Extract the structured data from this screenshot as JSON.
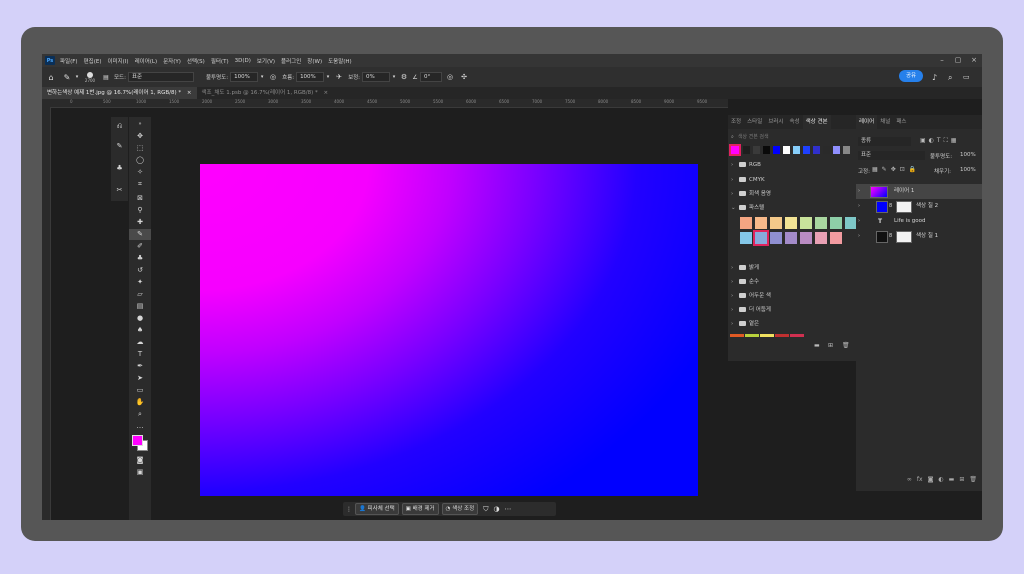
{
  "menu": {
    "logo": "Ps",
    "items": [
      "파일(F)",
      "편집(E)",
      "이미지(I)",
      "레이어(L)",
      "문자(Y)",
      "선택(S)",
      "필터(T)",
      "3D(D)",
      "보기(V)",
      "플러그인",
      "창(W)",
      "도움말(H)"
    ]
  },
  "options": {
    "brush_size": "2700",
    "mode_label": "모드:",
    "mode_value": "표준",
    "opacity_label": "불투명도:",
    "opacity_value": "100%",
    "flow_label": "흐름:",
    "flow_value": "100%",
    "smoothing_label": "보정:",
    "smoothing_value": "0%",
    "angle_value": "0°",
    "share_label": "공유"
  },
  "tabs": [
    {
      "label": "변하는색상 예제 1번.jpg @ 16.7%(레이어 1, RGB/8) *",
      "close": "×"
    },
    {
      "label": "색조_채도 1.psb @ 16.7%(레이어 1, RGB/8) *",
      "close": "×"
    }
  ],
  "ruler_ticks": [
    "0",
    "500",
    "1000",
    "1500",
    "2000",
    "2500",
    "3000",
    "3500",
    "4000",
    "4500",
    "5000",
    "5500",
    "6000",
    "6500",
    "7000",
    "7500",
    "8000",
    "8500",
    "9000",
    "9500"
  ],
  "taskbar": {
    "subject_label": "피사체 선택",
    "remove_bg_label": "배경 제거",
    "color_adjust_label": "색상 조정"
  },
  "swatches": {
    "tabs": [
      "조정",
      "스타일",
      "브러시",
      "속성",
      "색상 견본"
    ],
    "search_placeholder": "색상 견본 검색",
    "recent": [
      "#ff00ff",
      "#1e1e1e",
      "#3a3a3a",
      "#0a0a0a",
      "#0000ff",
      "#ffffff",
      "#87cefa",
      "#1e40ff",
      "#3030cc",
      "#2a2a2a",
      "#9090ff",
      "#888888"
    ],
    "groups": [
      {
        "label": "RGB",
        "open": false
      },
      {
        "label": "CMYK",
        "open": false
      },
      {
        "label": "회색 음영",
        "open": false
      },
      {
        "label": "파스텔",
        "open": true
      },
      {
        "label": "밝게",
        "open": false
      },
      {
        "label": "순수",
        "open": false
      },
      {
        "label": "어두운 색",
        "open": false
      },
      {
        "label": "더 어둡게",
        "open": false
      },
      {
        "label": "옅은",
        "open": false
      }
    ],
    "pastel": [
      "#f4a582",
      "#f7b98a",
      "#f4c98a",
      "#f2e394",
      "#c9e39b",
      "#a9d7a0",
      "#8ecfa8",
      "#7ec8c8",
      "#84c7e8",
      "#89a9dc",
      "#8f8fd1",
      "#a38bc9",
      "#b98bc2",
      "#e8a0b4",
      "#f29ba0"
    ],
    "partial_strip": [
      "#e05a24",
      "#b8d23c",
      "#f0e060",
      "#c03030",
      "#d03050"
    ]
  },
  "layers": {
    "tabs": [
      "레이어",
      "채널",
      "패스"
    ],
    "filter_label": "종류",
    "blend_value": "표준",
    "opacity_label": "불투명도:",
    "opacity_value": "100%",
    "lock_label": "고정:",
    "fill_label": "채우기:",
    "fill_value": "100%",
    "items": [
      {
        "name": "레이어 1",
        "kind": "gradient"
      },
      {
        "name": "색상 칠 2",
        "kind": "fill",
        "color": "#0000ff"
      },
      {
        "name": "Life is good",
        "kind": "text"
      },
      {
        "name": "색상 칠 1",
        "kind": "fill",
        "color": "#111111"
      }
    ]
  },
  "colors": {
    "foreground": "#ff00ff",
    "background": "#ffffff",
    "accent": "#2680eb"
  }
}
